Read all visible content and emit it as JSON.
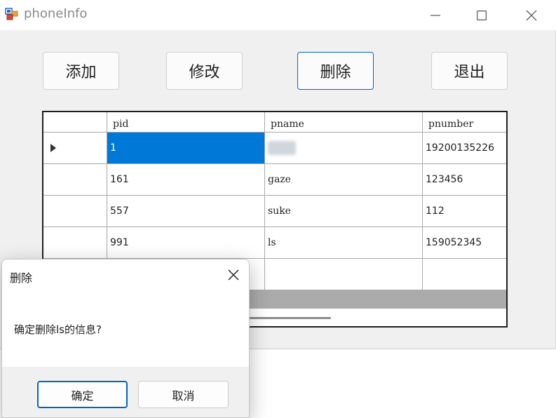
{
  "window": {
    "title": "phoneInfo"
  },
  "toolbar": {
    "add_label": "添加",
    "edit_label": "修改",
    "delete_label": "删除",
    "exit_label": "退出"
  },
  "grid": {
    "columns": [
      "pid",
      "pname",
      "pnumber"
    ],
    "rows": [
      {
        "pid": "1",
        "pname": "",
        "pnumber": "19200135226"
      },
      {
        "pid": "161",
        "pname": "gaze",
        "pnumber": "123456"
      },
      {
        "pid": "557",
        "pname": "suke",
        "pnumber": "112"
      },
      {
        "pid": "991",
        "pname": "ls",
        "pnumber": "159052345"
      }
    ]
  },
  "dialog": {
    "title": "删除",
    "message": "确定删除ls的信息?",
    "ok_label": "确定",
    "cancel_label": "取消"
  },
  "colors": {
    "accent": "#0078d7",
    "focus_border": "#0067c0",
    "window_bg": "#f0f0f0"
  },
  "icons": [
    "app-icon",
    "minimize-icon",
    "maximize-icon",
    "close-icon",
    "row-pointer-icon",
    "dialog-close-icon"
  ]
}
